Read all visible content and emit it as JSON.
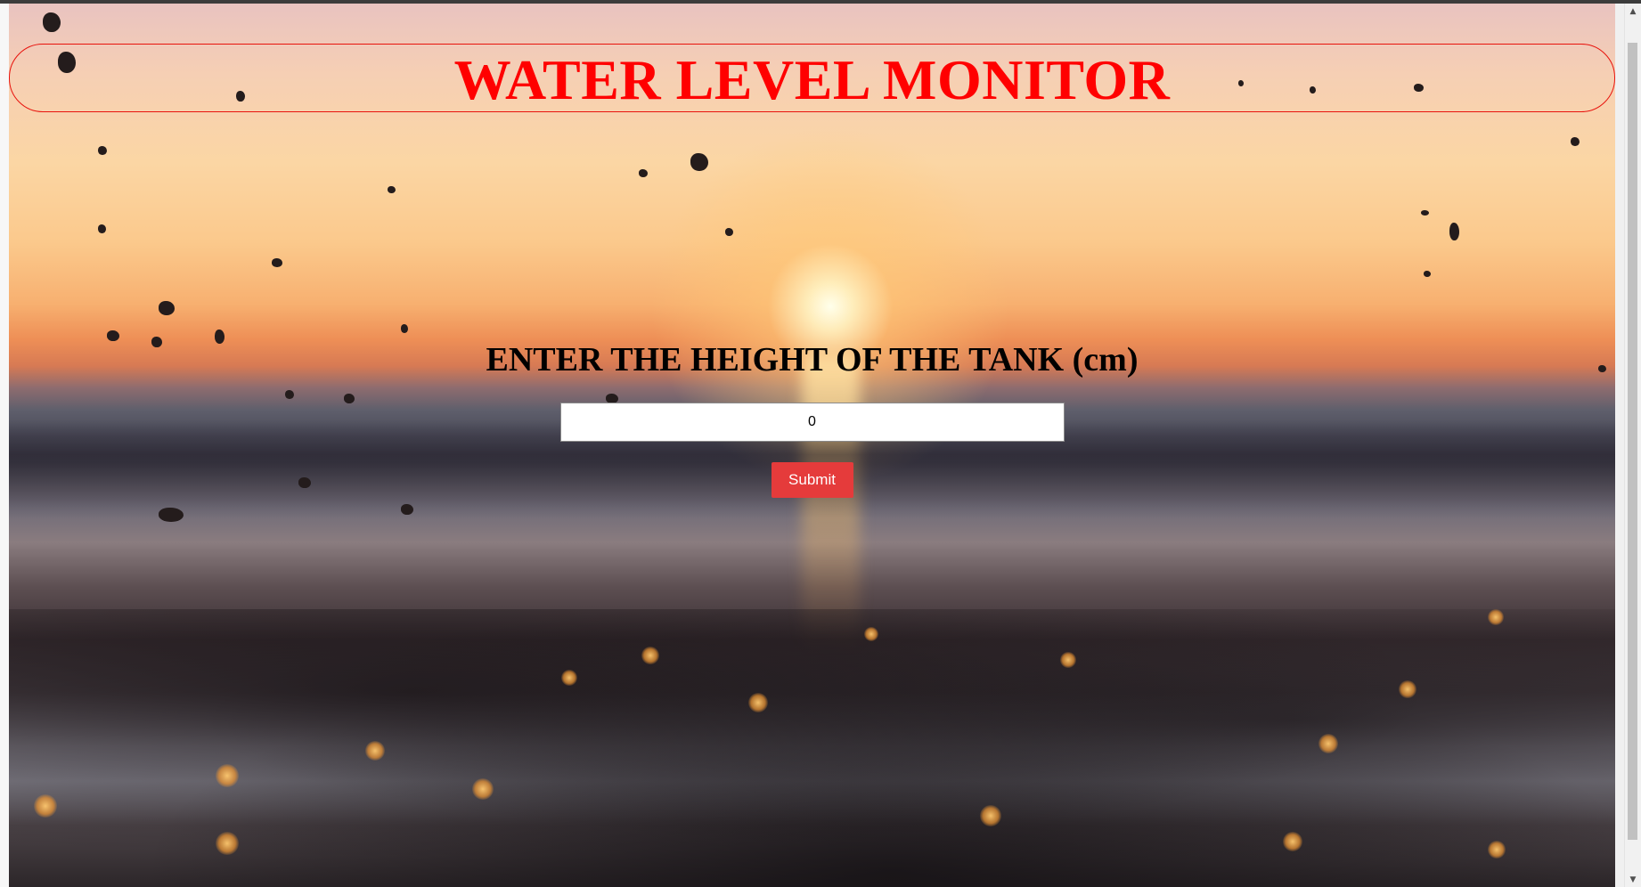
{
  "header": {
    "title": "WATER LEVEL MONITOR",
    "title_color": "#ff0000",
    "border_color": "#e8120c"
  },
  "form": {
    "label": "ENTER THE HEIGHT OF THE TANK (cm)",
    "height_input_value": "0",
    "submit_label": "Submit",
    "submit_color": "#e53b3b"
  },
  "background": {
    "description_icon": "sunset-beach-background"
  },
  "scrollbar": {
    "up_arrow": "▲",
    "down_arrow": "▼"
  }
}
